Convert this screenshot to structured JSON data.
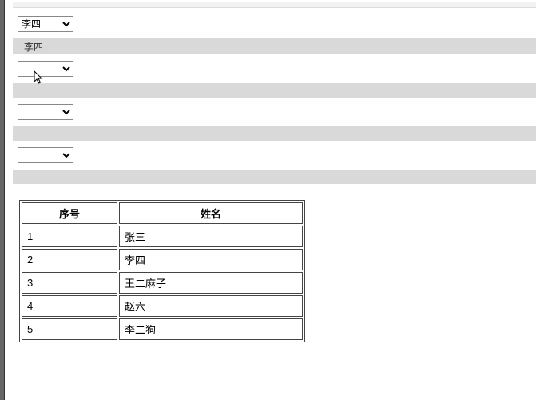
{
  "selects": [
    {
      "value": "李四"
    },
    {
      "value": ""
    },
    {
      "value": ""
    },
    {
      "value": ""
    }
  ],
  "band1_label": "李四",
  "table": {
    "headers": {
      "index": "序号",
      "name": "姓名"
    },
    "rows": [
      {
        "index": "1",
        "name": "张三"
      },
      {
        "index": "2",
        "name": "李四"
      },
      {
        "index": "3",
        "name": "王二麻子"
      },
      {
        "index": "4",
        "name": "赵六"
      },
      {
        "index": "5",
        "name": "李二狗"
      }
    ]
  }
}
